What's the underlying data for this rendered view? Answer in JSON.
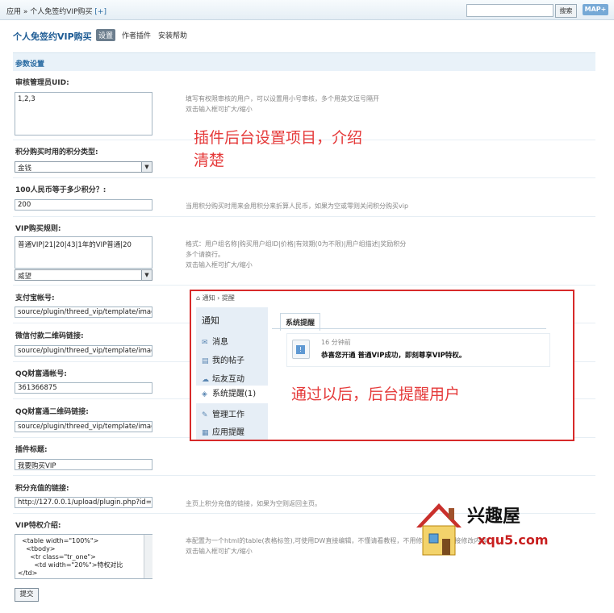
{
  "topbar": {
    "crumb_app": "应用",
    "crumb_sep": "»",
    "crumb_page": "个人免签约VIP购买",
    "crumb_add": "[+]",
    "search_button": "搜索",
    "map_button": "MAP+"
  },
  "header": {
    "title": "个人免签约VIP购买",
    "tabs": [
      "设置",
      "作者插件",
      "安装帮助"
    ]
  },
  "section_title": "参数设置",
  "fields": {
    "admin_uid": {
      "label": "审核管理员UID:",
      "value": "1,2,3",
      "hint1": "填写有权限审核的用户，可以设置用小号审核，多个用英文逗号隔开",
      "hint2": "双击输入框可扩大/缩小"
    },
    "credit_type": {
      "label": "积分购买时用的积分类型:",
      "value": "金钱"
    },
    "rate": {
      "label": "100人民币等于多少积分？:",
      "value": "200",
      "hint": "当用积分购买时用来会用积分来折算人民币，如果为空或零则关闭积分购买vip"
    },
    "rules": {
      "label": "VIP购买规则:",
      "value": "普通VIP|21|20|43|1年的VIP普通|20",
      "select_value": "威望",
      "hint1": "格式：用户组名称|购买用户组ID|价格|有效期(0为不限)|用户组描述|奖励积分",
      "hint2": "多个请换行。",
      "hint3": "双击输入框可扩大/缩小"
    },
    "alipay": {
      "label": "支付宝帐号:",
      "value": "source/plugin/threed_vip/template/imag"
    },
    "wechat": {
      "label": "微信付款二维码链接:",
      "value": "source/plugin/threed_vip/template/imag"
    },
    "qq": {
      "label": "QQ财富通帐号:",
      "value": "361366875"
    },
    "qq_qr": {
      "label": "QQ财富通二维码链接:",
      "value": "source/plugin/threed_vip/template/imag"
    },
    "plugin_title": {
      "label": "插件标题:",
      "value": "我要购买VIP"
    },
    "recharge_link": {
      "label": "积分充值的链接:",
      "value": "http://127.0.0.1/upload/plugin.php?id=t",
      "hint": "主页上积分充值的链接，如果为空则返回主页。"
    },
    "intro": {
      "label": "VIP特权介绍:",
      "value": "  <table width=\"100%\">\n    <tbody>\n      <tr class=\"tr_one\">\n        <td width=\"20%\">特权对比\n</td>",
      "hint1": "本配置为一个html的table(表格标签),可使用DW直接编辑，不懂请看教程，不用修改样式，直接修改内容",
      "hint2": "双击输入框可扩大/缩小"
    }
  },
  "submit_label": "提交",
  "annotation_top": "插件后台设置项目，介绍\n清楚",
  "notify_shot": {
    "breadcrumb": "通知 › 提醒",
    "sidebar_title": "通知",
    "sidebar_items": [
      "消息",
      "我的帖子",
      "坛友互动",
      "系统提醒(1)",
      "管理工作",
      "应用提醒"
    ],
    "tab": "系统提醒",
    "time": "16 分钟前",
    "message": "恭喜您开通 普通VIP成功，即刻尊享VIP特权。",
    "annotation": "通过以后，后台提醒用户"
  },
  "watermark": {
    "name": "兴趣屋",
    "url": "xqu5.com"
  },
  "colors": {
    "accent": "#1d5b94",
    "annotation": "#e53a3a",
    "frame": "#d72a2a"
  }
}
